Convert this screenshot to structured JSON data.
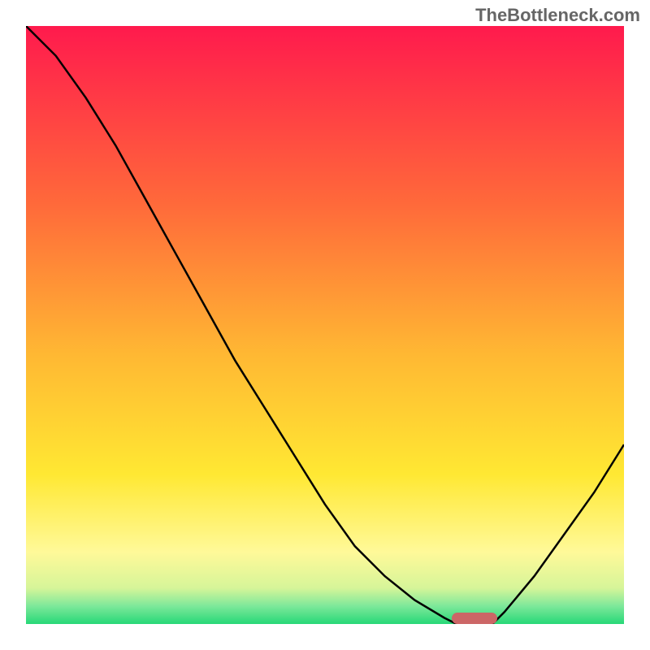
{
  "watermark": "TheBottleneck.com",
  "chart_data": {
    "type": "line",
    "title": "",
    "xlabel": "",
    "ylabel": "",
    "x": [
      0,
      5,
      10,
      15,
      20,
      25,
      30,
      35,
      40,
      45,
      50,
      55,
      60,
      65,
      70,
      72,
      75,
      78,
      80,
      85,
      90,
      95,
      100
    ],
    "values": [
      100,
      95,
      88,
      80,
      71,
      62,
      53,
      44,
      36,
      28,
      20,
      13,
      8,
      4,
      1,
      0,
      0,
      0,
      2,
      8,
      15,
      22,
      30
    ],
    "xlim": [
      0,
      100
    ],
    "ylim": [
      0,
      100
    ],
    "optimal_marker_x": 75,
    "gradient_stops": [
      {
        "pos": 0,
        "color": "#ff1a4d"
      },
      {
        "pos": 30,
        "color": "#ff6a3a"
      },
      {
        "pos": 55,
        "color": "#ffb833"
      },
      {
        "pos": 75,
        "color": "#ffe833"
      },
      {
        "pos": 88,
        "color": "#fff999"
      },
      {
        "pos": 94,
        "color": "#d6f599"
      },
      {
        "pos": 97,
        "color": "#7de89a"
      },
      {
        "pos": 100,
        "color": "#27d877"
      }
    ]
  }
}
